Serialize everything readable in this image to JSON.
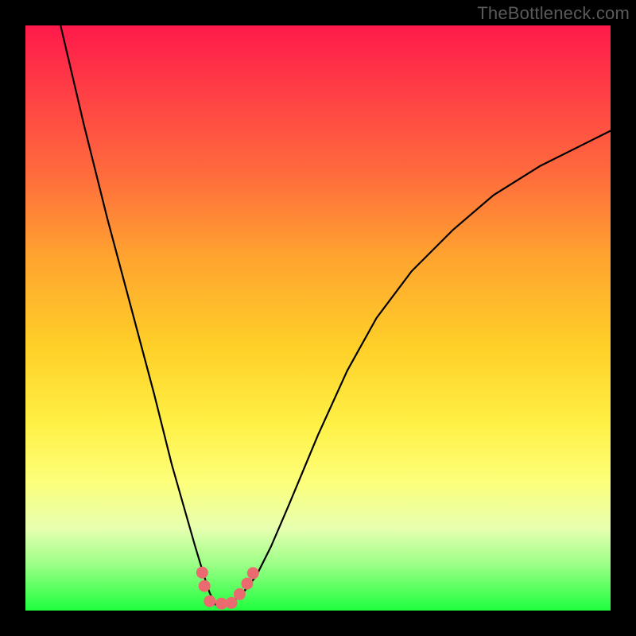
{
  "watermark": "TheBottleneck.com",
  "chart_data": {
    "type": "line",
    "title": "",
    "xlabel": "",
    "ylabel": "",
    "xlim": [
      0,
      100
    ],
    "ylim": [
      0,
      100
    ],
    "grid": false,
    "series": [
      {
        "name": "curve",
        "x": [
          6,
          10,
          14,
          18,
          22,
          25,
          27,
          29,
          30.5,
          31.5,
          32.5,
          33.5,
          35,
          37,
          39.5,
          42,
          45,
          50,
          55,
          60,
          66,
          73,
          80,
          88,
          96,
          100
        ],
        "y": [
          100,
          83,
          67,
          52,
          37,
          25,
          18,
          11,
          6,
          3,
          1,
          1,
          1.2,
          2.8,
          6,
          11,
          18,
          30,
          41,
          50,
          58,
          65,
          71,
          76,
          80,
          82
        ]
      }
    ],
    "markers": [
      {
        "x": 30.2,
        "y": 6.5
      },
      {
        "x": 30.6,
        "y": 4.2
      },
      {
        "x": 31.5,
        "y": 1.6
      },
      {
        "x": 33.5,
        "y": 1.2
      },
      {
        "x": 35.2,
        "y": 1.3
      },
      {
        "x": 36.6,
        "y": 2.8
      },
      {
        "x": 37.9,
        "y": 4.6
      },
      {
        "x": 38.9,
        "y": 6.4
      }
    ]
  }
}
